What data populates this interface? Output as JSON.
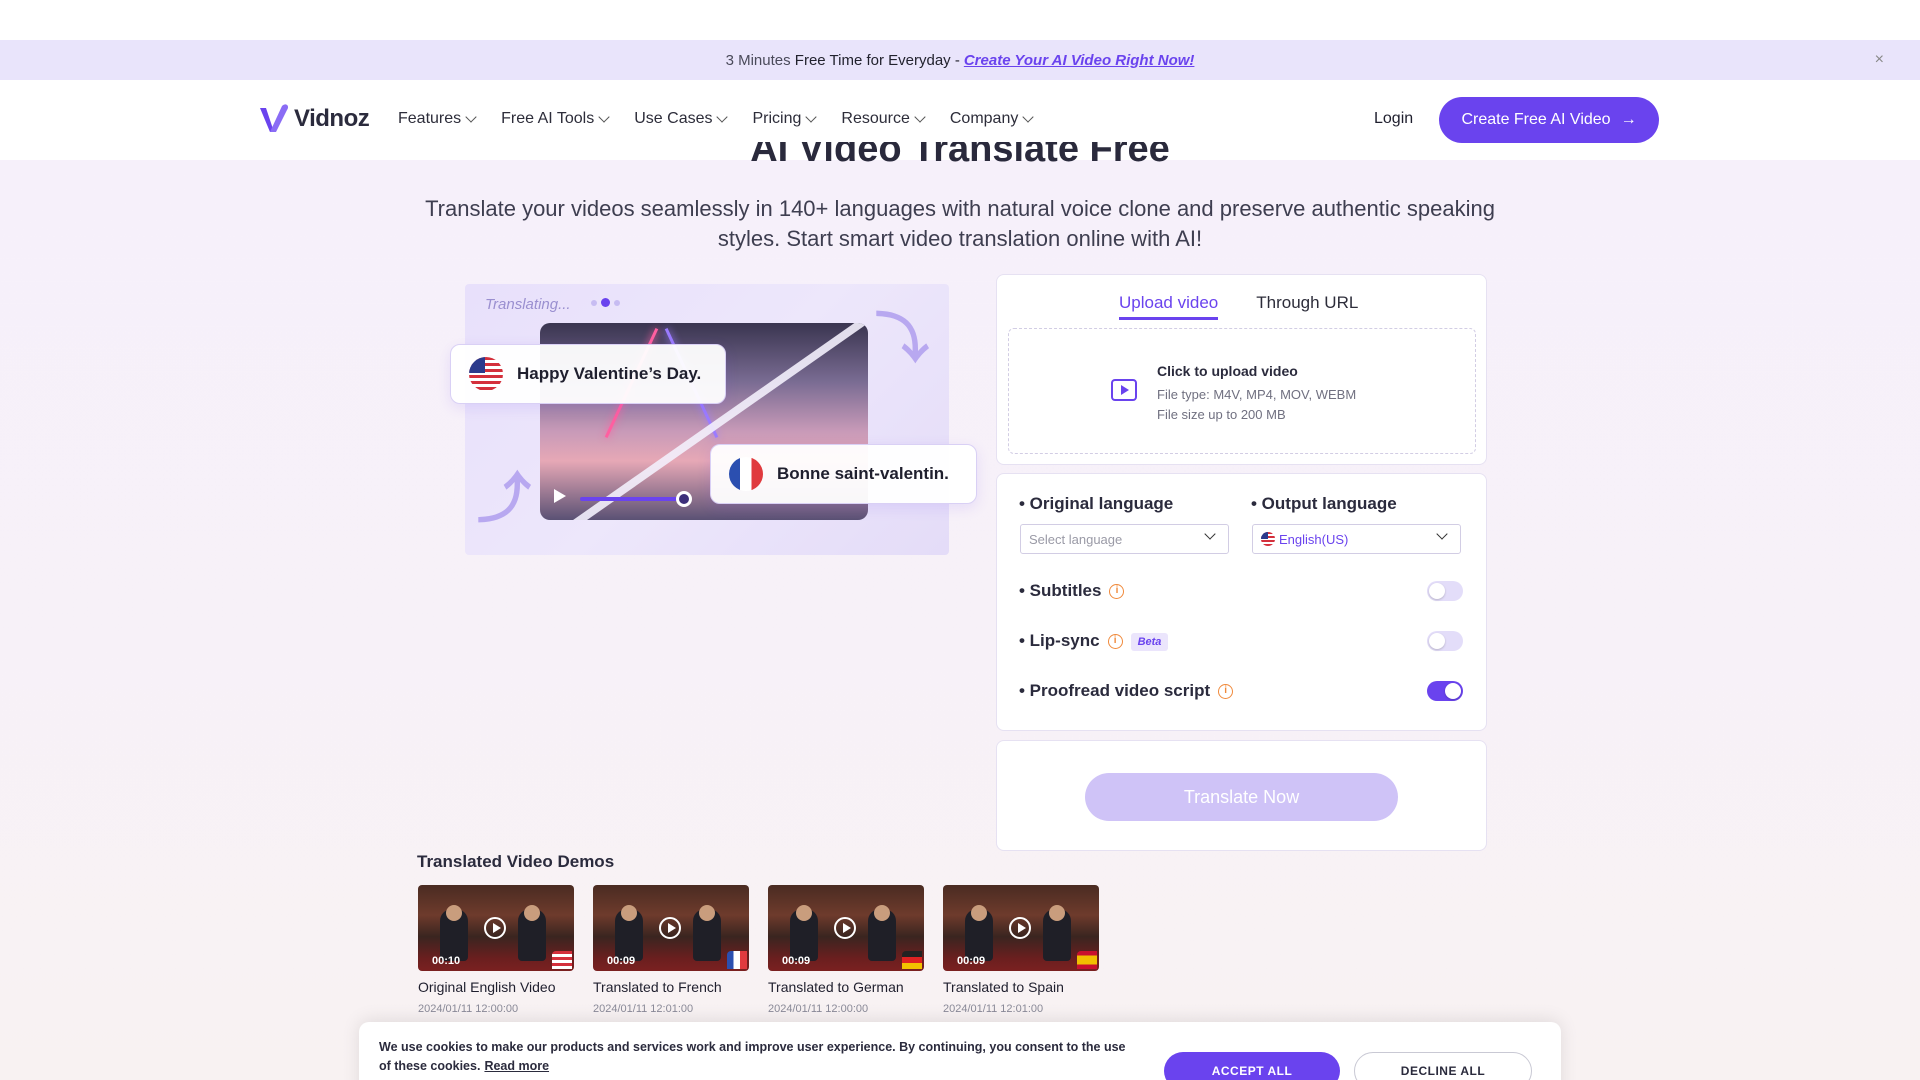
{
  "announcement": {
    "prefix": "3 Minutes",
    "mid": "Free Time for Everyday -",
    "link": "Create Your AI Video Right Now!",
    "close": "×"
  },
  "nav": {
    "logo": "Vidnoz",
    "menu": [
      "Features",
      "Free AI Tools",
      "Use Cases",
      "Pricing",
      "Resource",
      "Company"
    ],
    "login": "Login",
    "cta": "Create Free AI Video",
    "cta_arrow": "→"
  },
  "hero": {
    "title": "AI Video Translate Free",
    "subtitle": "Translate your videos seamlessly in 140+ languages with natural voice clone and preserve authentic speaking styles. Start smart video translation online with AI!"
  },
  "illustration": {
    "status": "Translating...",
    "source_phrase": "Happy Valentine’s Day.",
    "target_phrase": "Bonne saint-valentin."
  },
  "upload": {
    "tabs": [
      "Upload video",
      "Through URL"
    ],
    "active_tab": 0,
    "title": "Click to upload video",
    "file_types": "File type: M4V, MP4, MOV, WEBM",
    "file_size": "File size up to 200 MB"
  },
  "settings": {
    "original_language_label": "• Original language",
    "original_language_placeholder": "Select language",
    "output_language_label": "• Output language",
    "output_language_value": "English(US)",
    "subtitles_label": "• Subtitles",
    "subtitles_on": false,
    "lipsync_label": "• Lip-sync",
    "lipsync_badge": "Beta",
    "lipsync_on": false,
    "proofread_label": "• Proofread video script",
    "proofread_on": true,
    "info_glyph": "i"
  },
  "action": {
    "translate_button": "Translate Now"
  },
  "demos": {
    "title": "Translated Video Demos",
    "items": [
      {
        "duration": "00:10",
        "name": "Original English Video",
        "date": "2024/01/11 12:00:00",
        "flag": "us"
      },
      {
        "duration": "00:09",
        "name": "Translated to French",
        "date": "2024/01/11 12:01:00",
        "flag": "fr"
      },
      {
        "duration": "00:09",
        "name": "Translated to German",
        "date": "2024/01/11 12:00:00",
        "flag": "de"
      },
      {
        "duration": "00:09",
        "name": "Translated to Spain",
        "date": "2024/01/11 12:01:00",
        "flag": "es"
      }
    ]
  },
  "cookie": {
    "message": "We use cookies to make our products and services work and improve user experience. By continuing, you consent to the use of these cookies.",
    "read_more": "Read more",
    "accept": "ACCEPT ALL",
    "decline": "DECLINE ALL"
  },
  "colors": {
    "accent": "#6a43ee",
    "banner_bg": "#e9e4fb",
    "info": "#f08a3c"
  }
}
